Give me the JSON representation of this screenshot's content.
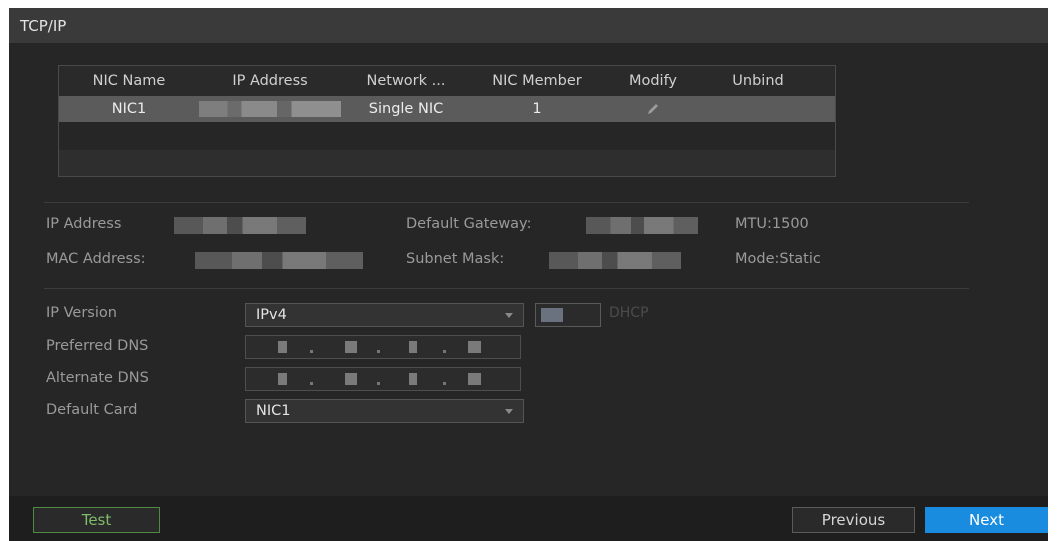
{
  "title": "TCP/IP",
  "nic_table": {
    "headers": [
      "NIC Name",
      "IP Address",
      "Network ...",
      "NIC Member",
      "Modify",
      "Unbind"
    ],
    "rows": [
      {
        "name": "NIC1",
        "ip": "",
        "network": "Single NIC",
        "member": "1",
        "modify_icon": "pencil-icon"
      }
    ]
  },
  "info": {
    "ip_address_label": "IP Address",
    "default_gateway_label": "Default Gateway:",
    "mtu": "MTU:1500",
    "mac_address_label": "MAC Address:",
    "subnet_mask_label": "Subnet Mask:",
    "mode": "Mode:Static"
  },
  "form": {
    "ip_version_label": "IP Version",
    "ip_version_value": "IPv4",
    "dhcp_label": "DHCP",
    "preferred_dns_label": "Preferred DNS",
    "alternate_dns_label": "Alternate DNS",
    "default_card_label": "Default Card",
    "default_card_value": "NIC1"
  },
  "footer": {
    "test_label": "Test",
    "previous_label": "Previous",
    "next_label": "Next"
  },
  "colors": {
    "next_button": "#1a8ce0",
    "test_button_border": "#4f8a43",
    "selected_row": "#5b5b5b"
  }
}
